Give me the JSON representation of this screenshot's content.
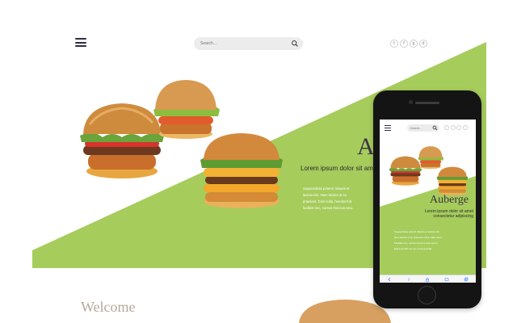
{
  "site": {
    "brand_title": "Auberge",
    "hero_subtitle": "Lorem ipsum dolor sit amet consectetur adipiscing",
    "hero_paragraph": "Suspendisse potenti. Mauris et\nlacinia nisi. Nam lacinia ut eu\npraesent. Duis nulla, hendrerit id\nfacilisis nec, cursus rhoncus arcu.",
    "welcome_heading": "Welcome",
    "search": {
      "placeholder": "Search...",
      "value": ""
    },
    "social_icons": [
      "twitter-icon",
      "facebook-icon",
      "google-plus-icon",
      "dribbble-icon"
    ],
    "social_glyphs": [
      "t",
      "f",
      "g",
      "d"
    ]
  },
  "mobile": {
    "brand_title": "Auberge",
    "hero_subtitle": "Lorem ipsum dolor sit amet consectetur adipiscing",
    "hero_paragraph": "Suspendisse potenti. Mauris et lacinia nisi.\nNam lacinia ut eu praesent. Duis nulla, hend.\nFacilisis nec, cursus rhoncus arcu lorem.\nEtiam id nibh nec leo porta gravida.",
    "search": {
      "placeholder": "Search...",
      "value": ""
    },
    "toolbar_icons": [
      "back-icon",
      "forward-icon",
      "share-icon",
      "bookmarks-icon",
      "tabs-icon"
    ]
  },
  "colors": {
    "accent_green": "#a6cc5c",
    "dark_text": "#3a3542",
    "welcome_tan": "#b7a897",
    "phone_body": "#141414"
  }
}
